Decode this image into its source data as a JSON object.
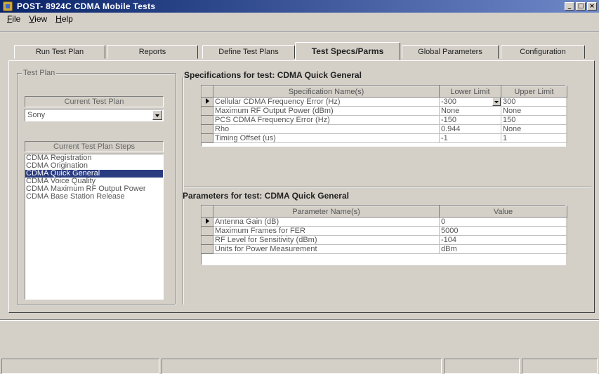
{
  "window": {
    "title": "POST-    8924C CDMA Mobile Tests"
  },
  "menu": [
    {
      "label": "File",
      "ul": "F",
      "rest": "ile"
    },
    {
      "label": "View",
      "ul": "V",
      "rest": "iew"
    },
    {
      "label": "Help",
      "ul": "H",
      "rest": "elp"
    }
  ],
  "tabs": [
    {
      "label": "Run Test Plan",
      "active": false
    },
    {
      "label": "Reports",
      "active": false
    },
    {
      "label": "Define Test Plans",
      "active": false
    },
    {
      "label": "Test Specs/Parms",
      "active": true
    },
    {
      "label": "Global Parameters",
      "active": false
    },
    {
      "label": "Configuration",
      "active": false
    }
  ],
  "test_plan": {
    "group_title": "Test Plan",
    "current_label": "Current Test Plan",
    "current_value": "Sony",
    "steps_label": "Current Test Plan Steps",
    "steps": [
      "CDMA Registration",
      "CDMA Origination",
      "CDMA Quick General",
      "CDMA Voice Quality",
      "CDMA Maximum RF Output Power",
      "CDMA Base Station Release"
    ],
    "selected_step": 2
  },
  "specs": {
    "title": "Specifications for test: CDMA Quick General",
    "columns": [
      "Specification Name(s)",
      "Lower Limit",
      "Upper Limit"
    ],
    "rows": [
      {
        "name": "Cellular CDMA Frequency Error (Hz)",
        "lower": "-300",
        "upper": "300"
      },
      {
        "name": "Maximum RF Output Power (dBm)",
        "lower": "None",
        "upper": "None"
      },
      {
        "name": "PCS CDMA Frequency Error (Hz)",
        "lower": "-150",
        "upper": "150"
      },
      {
        "name": "Rho",
        "lower": "0.944",
        "upper": "None"
      },
      {
        "name": "Timing Offset (us)",
        "lower": "-1",
        "upper": "1"
      }
    ]
  },
  "params": {
    "title": "Parameters for test: CDMA Quick General",
    "columns": [
      "Parameter Name(s)",
      "Value"
    ],
    "rows": [
      {
        "name": "Antenna Gain (dB)",
        "value": "0"
      },
      {
        "name": "Maximum Frames for FER",
        "value": "5000"
      },
      {
        "name": "RF Level for Sensitivity (dBm)",
        "value": "-104"
      },
      {
        "name": "Units for Power Measurement",
        "value": "dBm"
      }
    ]
  }
}
